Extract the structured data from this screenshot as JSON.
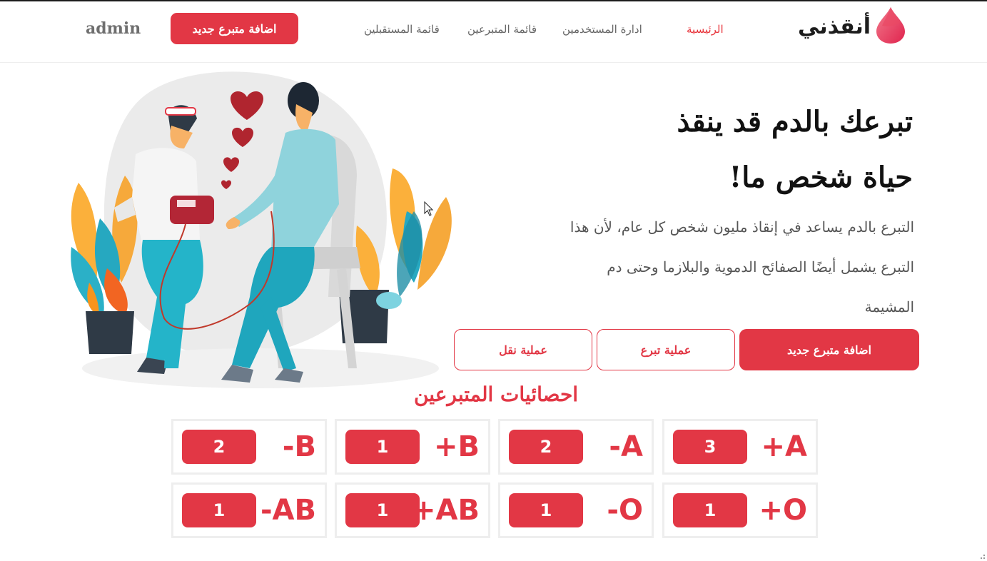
{
  "navbar": {
    "logo_text": "أنقذني",
    "links": [
      {
        "label": "الرئيسية",
        "active": true
      },
      {
        "label": "ادارة المستخدمين",
        "active": false
      },
      {
        "label": "قائمة المتبرعين",
        "active": false
      },
      {
        "label": "قائمة المستقبلين",
        "active": false
      }
    ],
    "add_donor_label": "اضافة متبرع جديد",
    "user_name": "admin"
  },
  "hero": {
    "title_line1": "تبرعك بالدم قد ينقذ",
    "title_line2": "حياة شخص ما!",
    "description_line1": "التبرع بالدم يساعد في إنقاذ مليون شخص كل عام، لأن هذا",
    "description_line2": "التبرع يشمل أيضًا الصفائح الدموية والبلازما وحتى دم",
    "description_line3": "المشيمة",
    "buttons": {
      "add_donor": "اضافة متبرع جديد",
      "donation": "عملية تبرع",
      "transfer": "عملية نقل"
    }
  },
  "stats": {
    "title": "احصائيات المتبرعين",
    "groups": [
      {
        "type": "A+",
        "count": "3"
      },
      {
        "type": "A-",
        "count": "2"
      },
      {
        "type": "B+",
        "count": "1"
      },
      {
        "type": "B-",
        "count": "2"
      },
      {
        "type": "O+",
        "count": "1"
      },
      {
        "type": "O-",
        "count": "1"
      },
      {
        "type": "AB+",
        "count": "1"
      },
      {
        "type": "AB-",
        "count": "1"
      }
    ]
  },
  "colors": {
    "accent": "#e23745",
    "nav_active": "#e8353c",
    "text_muted": "#666666",
    "card_border": "#eeeeee"
  },
  "icons": {
    "logo": "blood-drop-icon",
    "cursor": "mouse-pointer-icon",
    "resize": "resize-grip-icon"
  }
}
